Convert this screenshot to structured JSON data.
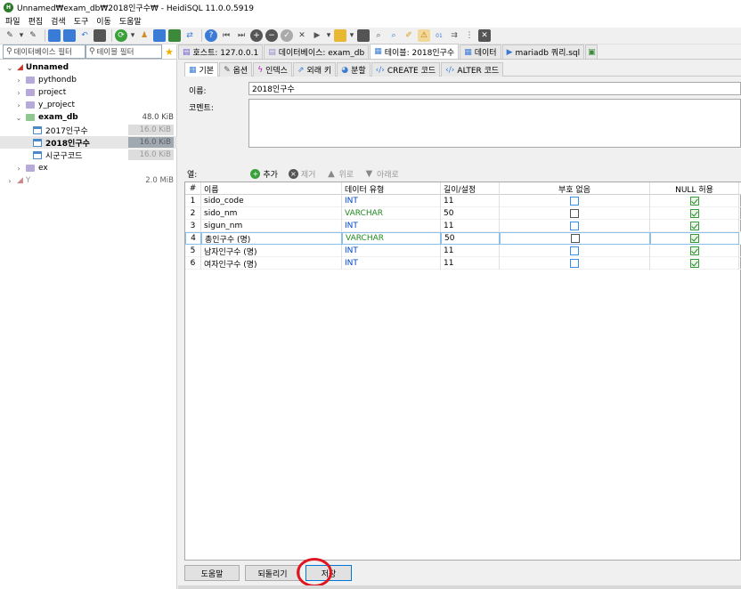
{
  "window": {
    "title": "Unnamed₩exam_db₩2018인구수₩ - HeidiSQL 11.0.0.5919"
  },
  "menu": [
    "파일",
    "편집",
    "검색",
    "도구",
    "이동",
    "도움말"
  ],
  "filters": {
    "db_filter": "데이터베이스 필터",
    "table_filter": "테이블 필터"
  },
  "tree": {
    "server": "Unnamed",
    "databases": [
      {
        "name": "pythondb",
        "size": ""
      },
      {
        "name": "project",
        "size": ""
      },
      {
        "name": "y_project",
        "size": ""
      },
      {
        "name": "exam_db",
        "size": "48.0 KiB"
      }
    ],
    "tables": [
      {
        "name": "2017인구수",
        "size": "16.0 KiB"
      },
      {
        "name": "2018인구수",
        "size": "16.0 KiB"
      },
      {
        "name": "시군구코드",
        "size": "16.0 KiB"
      }
    ],
    "after": {
      "name": "ex",
      "size": ""
    },
    "server2": {
      "name": "Y",
      "size": "2.0 MiB"
    }
  },
  "tabs": [
    {
      "label": "호스트: 127.0.0.1"
    },
    {
      "label": "데이터베이스: exam_db"
    },
    {
      "label": "테이블: 2018인구수"
    },
    {
      "label": "데이터"
    },
    {
      "label": "mariadb 쿼리.sql"
    }
  ],
  "subtabs": [
    "기본",
    "옵션",
    "인덱스",
    "외래 키",
    "분할",
    "CREATE 코드",
    "ALTER 코드"
  ],
  "form": {
    "name_label": "이름:",
    "name_value": "2018인구수",
    "comment_label": "코멘트:"
  },
  "columns_bar": {
    "label": "열:",
    "add": "추가",
    "remove": "제거",
    "up": "위로",
    "down": "아래로"
  },
  "grid": {
    "headers": [
      "#",
      "이름",
      "데이터 유형",
      "길이/설정",
      "부호 없음",
      "NULL 허용"
    ],
    "rows": [
      {
        "n": "1",
        "name": "sido_code",
        "type": "INT",
        "len": "11"
      },
      {
        "n": "2",
        "name": "sido_nm",
        "type": "VARCHAR",
        "len": "50"
      },
      {
        "n": "3",
        "name": "sigun_nm",
        "type": "INT",
        "len": "11"
      },
      {
        "n": "4",
        "name": "총인구수 (명)",
        "type": "VARCHAR",
        "len": "50"
      },
      {
        "n": "5",
        "name": "남자인구수 (명)",
        "type": "INT",
        "len": "11"
      },
      {
        "n": "6",
        "name": "여자인구수 (명)",
        "type": "INT",
        "len": "11"
      }
    ]
  },
  "buttons": {
    "help": "도움말",
    "revert": "되돌리기",
    "save": "저장"
  },
  "colors": {
    "int_type": "#0045c8",
    "varchar_type": "#1f8a1f",
    "highlight_circle": "#e0151f"
  }
}
